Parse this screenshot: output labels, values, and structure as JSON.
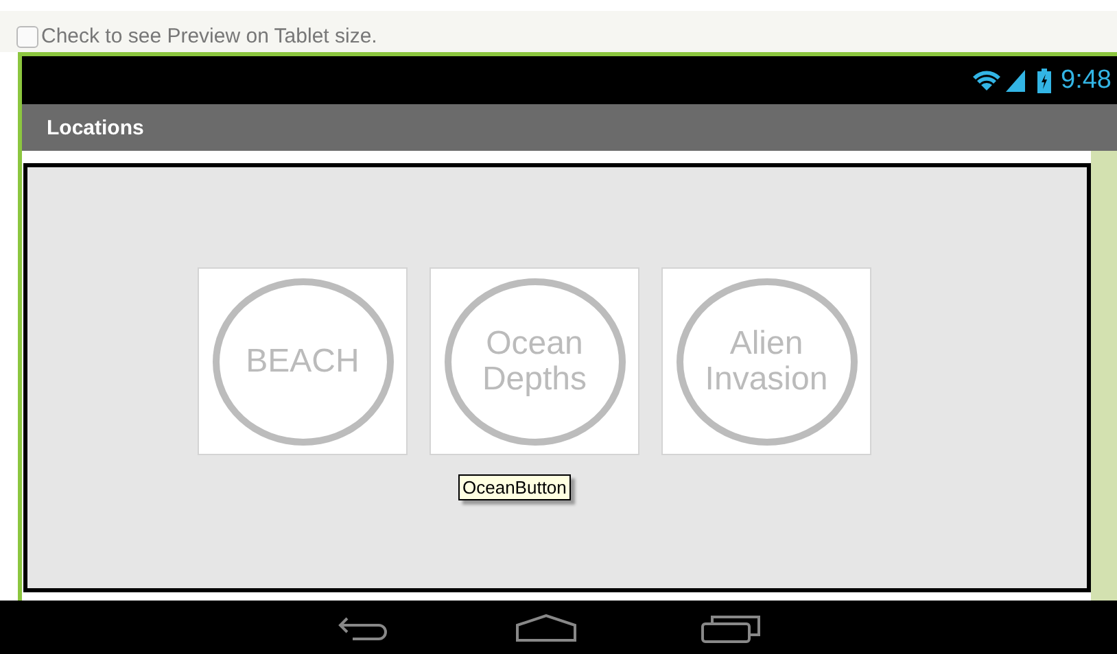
{
  "preview_option": {
    "label": "Check to see Preview on Tablet size.",
    "checked": false
  },
  "status_bar": {
    "time": "9:48"
  },
  "title_bar": {
    "title": "Locations"
  },
  "buttons": [
    {
      "label": "BEACH"
    },
    {
      "label": "Ocean Depths"
    },
    {
      "label": "Alien Invasion"
    }
  ],
  "tooltip": {
    "text": "OceanButton"
  }
}
